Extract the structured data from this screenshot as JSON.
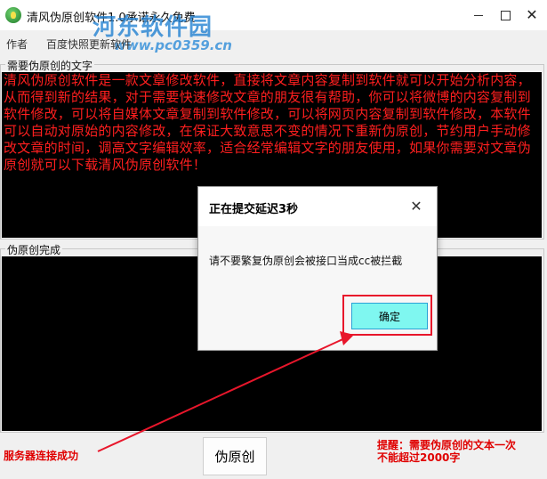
{
  "window": {
    "title": "清风伪原创软件1.0承诺永久免费",
    "watermark": "河东软件园",
    "watermark_url": "www.pc0359.cn",
    "controls": {
      "minimize": "minimize",
      "maximize": "maximize",
      "close": "✕"
    }
  },
  "menu": {
    "items": [
      {
        "label": "作者"
      },
      {
        "label": "百度快照更新软件"
      }
    ]
  },
  "input_group": {
    "label": "需要伪原创的文字",
    "text": "清风伪原创软件是一款文章修改软件，直接将文章内容复制到软件就可以开始分析内容，从而得到新的结果，对于需要快速修改文章的朋友很有帮助，你可以将微博的内容复制到软件修改，可以将自媒体文章复制到软件修改，可以将网页内容复制到软件修改，本软件可以自动对原始的内容修改，在保证大致意思不变的情况下重新伪原创，节约用户手动修改文章的时间，调高文字编辑效率，适合经常编辑文字的朋友使用，如果你需要对文章伪原创就可以下载清风伪原创软件！"
  },
  "output_group": {
    "label": "伪原创完成",
    "text": ""
  },
  "footer": {
    "status": "服务器连接成功",
    "rewrite_button": "伪原创",
    "tip_line1": "提醒：需要伪原创的文本一次",
    "tip_line2": "不能超过2000字"
  },
  "dialog": {
    "title": "正在提交延迟3秒",
    "close": "✕",
    "message": "请不要繁复伪原创会被接口当成cc被拦截",
    "ok_button": "确定"
  },
  "colors": {
    "text_red": "#ff1f1f",
    "annotation_red": "#e8162b",
    "ok_button_bg": "#7ff7f0"
  }
}
